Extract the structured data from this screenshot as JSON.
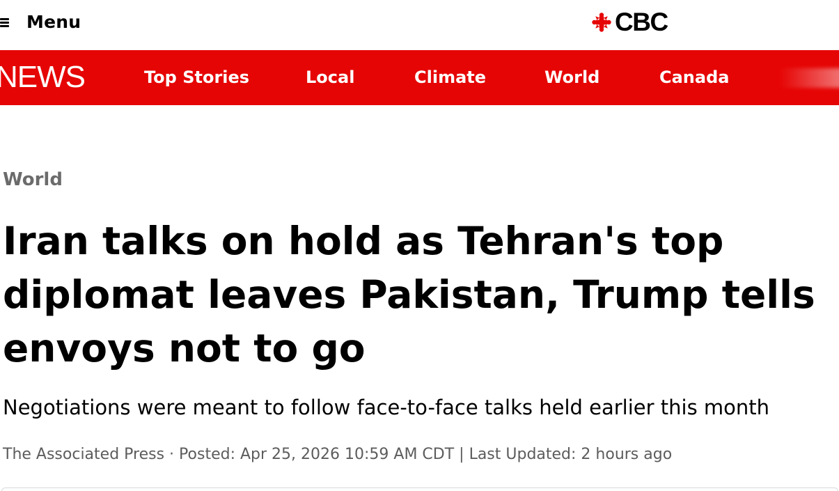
{
  "header": {
    "menu_label": "Menu",
    "brand_text": "CBC",
    "brand_color": "#e60505"
  },
  "nav": {
    "section_label": "NEWS",
    "background_color": "#e60505",
    "items": [
      {
        "label": "Top Stories"
      },
      {
        "label": "Local"
      },
      {
        "label": "Climate"
      },
      {
        "label": "World"
      },
      {
        "label": "Canada"
      }
    ]
  },
  "article": {
    "category": "World",
    "headline": "Iran talks on hold as Tehran's top diplomat leaves Pakistan, Trump tells envoys not to go",
    "deck": "Negotiations were meant to follow face-to-face talks held earlier this month",
    "byline": {
      "author": "The Associated Press",
      "separator": " · ",
      "posted": "Posted: Apr 25, 2026 10:59 AM CDT",
      "divider": " | ",
      "updated": "Last Updated: 2 hours ago"
    }
  },
  "icons": {
    "menu": "hamburger-menu-icon",
    "brand": "cbc-gem-logo-icon"
  }
}
